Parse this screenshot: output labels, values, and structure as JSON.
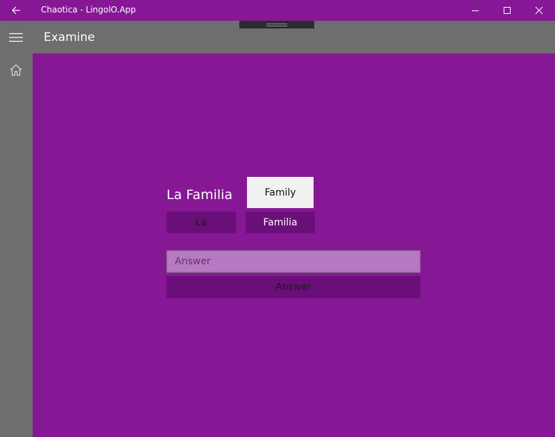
{
  "window": {
    "title": "Chaotica - LingolO.App",
    "back_icon": "arrow-left-icon",
    "minimize_icon": "minimize-icon",
    "maximize_icon": "maximize-icon",
    "close_icon": "close-icon"
  },
  "header": {
    "menu_icon": "hamburger-icon",
    "page_title": "Examine"
  },
  "nav": {
    "home_icon": "home-icon"
  },
  "exercise": {
    "phrase": "La Familia",
    "translation": "Family",
    "words": [
      {
        "label": "La"
      },
      {
        "label": "Familia"
      }
    ],
    "answer_placeholder": "Answer",
    "answer_value": "",
    "submit_label": "Answer"
  },
  "colors": {
    "accent": "#861896",
    "chrome": "#6e6e6e",
    "button": "#6a0f79",
    "input": "#b779c2",
    "card": "#f1f1f1"
  }
}
